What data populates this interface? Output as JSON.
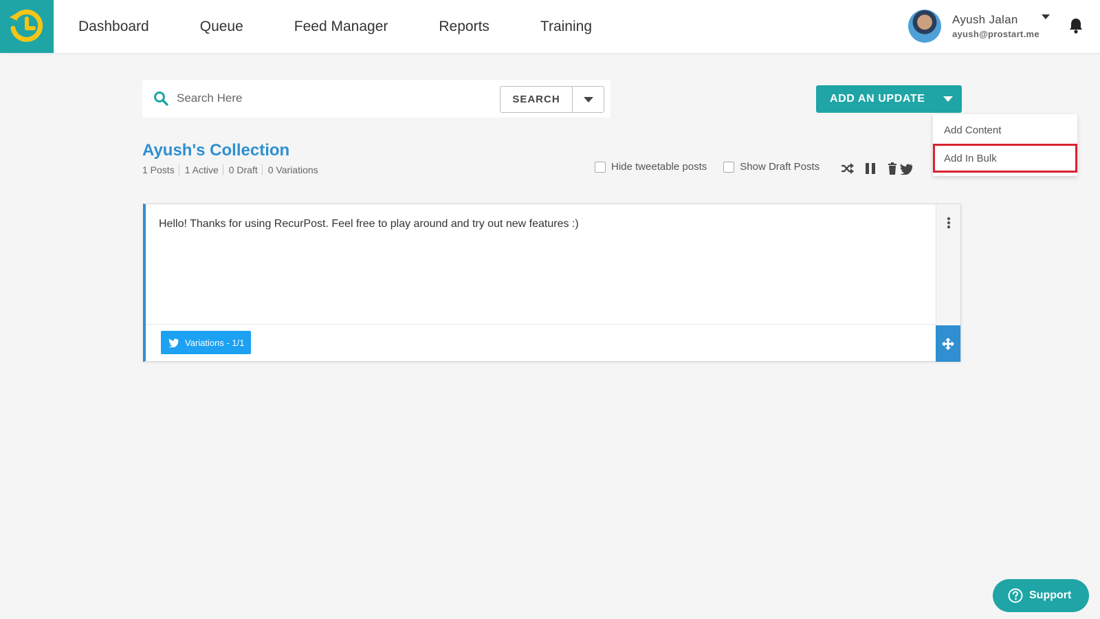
{
  "nav": {
    "items": [
      {
        "label": "Dashboard"
      },
      {
        "label": "Queue"
      },
      {
        "label": "Feed Manager"
      },
      {
        "label": "Reports"
      },
      {
        "label": "Training"
      }
    ]
  },
  "user": {
    "name": "Ayush Jalan",
    "email": "ayush@prostart.me"
  },
  "search": {
    "placeholder": "Search Here",
    "button_label": "SEARCH"
  },
  "add_update": {
    "label": "ADD AN UPDATE",
    "menu": [
      {
        "label": "Add Content"
      },
      {
        "label": "Add In Bulk",
        "highlighted": true
      }
    ]
  },
  "collection": {
    "title": "Ayush's Collection",
    "stats": [
      "1 Posts",
      "1 Active",
      "0 Draft",
      "0 Variations"
    ],
    "toggles": [
      {
        "label": "Hide tweetable posts",
        "checked": false
      },
      {
        "label": "Show Draft Posts",
        "checked": false
      }
    ]
  },
  "post": {
    "text": "Hello! Thanks for using RecurPost. Feel free to play around and try out new features :)",
    "variations_label": "Variations - 1/1"
  },
  "support": {
    "label": "Support"
  },
  "colors": {
    "brand": "#1fa5a5",
    "title_blue": "#2f8fd0",
    "twitter_blue": "#1da1f2",
    "highlight_red": "#d9232f",
    "logo_yellow": "#f5c518"
  }
}
